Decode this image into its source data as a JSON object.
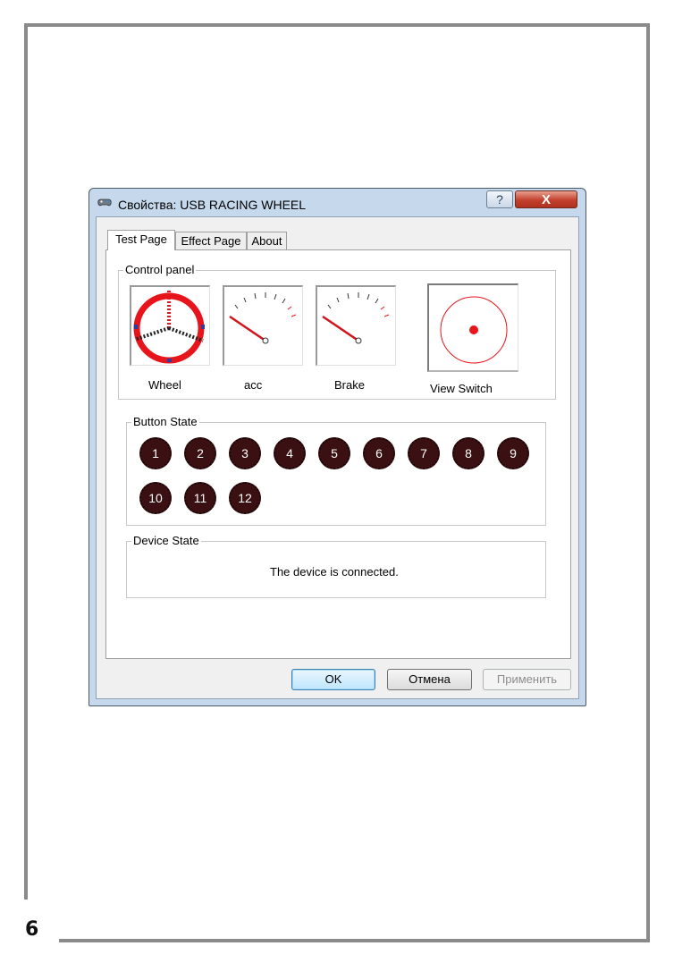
{
  "page": {
    "number": "6"
  },
  "dialog": {
    "title": "Свойства: USB RACING WHEEL",
    "help_label": "?",
    "close_label": "X"
  },
  "tabs": [
    {
      "label": "Test Page"
    },
    {
      "label": "Effect Page"
    },
    {
      "label": "About"
    }
  ],
  "control_panel": {
    "label": "Control panel",
    "wheel_label": "Wheel",
    "acc_label": "acc",
    "brake_label": "Brake",
    "view_switch_label": "View Switch"
  },
  "button_state": {
    "label": "Button State",
    "buttons": [
      "1",
      "2",
      "3",
      "4",
      "5",
      "6",
      "7",
      "8",
      "9",
      "10",
      "11",
      "12"
    ]
  },
  "device_state": {
    "label": "Device State",
    "status": "The device is connected."
  },
  "footer": {
    "ok_label": "OK",
    "cancel_label": "Отмена",
    "apply_label": "Применить"
  },
  "colors": {
    "wheel_ring": "#e8141c",
    "needle": "#d2141c",
    "button_fill": "#3b1012",
    "view_dot": "#e8141c"
  }
}
